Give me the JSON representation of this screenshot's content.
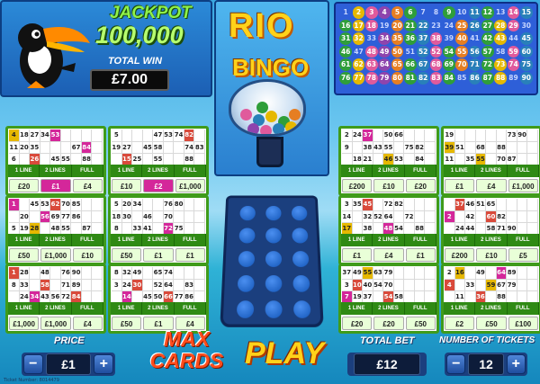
{
  "jackpot": {
    "label": "JACKPOT",
    "value": "100,000"
  },
  "total_win": {
    "label": "TOTAL WIN",
    "value": "£7.00"
  },
  "logo": {
    "line1": "RIO",
    "line2": "BINGO"
  },
  "balls": {
    "numbers": [
      1,
      2,
      3,
      4,
      5,
      6,
      7,
      8,
      9,
      10,
      11,
      12,
      13,
      14,
      15,
      16,
      17,
      18,
      19,
      20,
      21,
      22,
      23,
      24,
      25,
      26,
      27,
      28,
      29,
      30,
      31,
      32,
      33,
      34,
      35,
      36,
      37,
      38,
      39,
      40,
      41,
      42,
      43,
      44,
      45,
      46,
      47,
      48,
      49,
      50,
      51,
      52,
      52,
      54,
      55,
      56,
      57,
      58,
      59,
      60,
      61,
      62,
      63,
      64,
      65,
      66,
      67,
      68,
      69,
      70,
      71,
      72,
      73,
      74,
      75,
      76,
      77,
      78,
      79,
      80,
      81,
      82,
      83,
      84,
      85,
      86,
      87,
      88,
      89,
      90
    ],
    "colors": [
      "#2f9e3a",
      "#e6b800",
      "#e05a9c",
      "#8e44ad",
      "#e67e22",
      "#2f9e3a",
      "#2980b9",
      "#e05a9c",
      "#2f9e3a",
      "#e67e22",
      "#2980b9",
      "#2f9e3a",
      "#e6b800",
      "#e05a9c",
      "#2980b9"
    ],
    "called": [
      2,
      3,
      4,
      5,
      6,
      9,
      11,
      12,
      14,
      15,
      16,
      17,
      18,
      20,
      21,
      22,
      25,
      26,
      27,
      28,
      29,
      31,
      32,
      34,
      35,
      36,
      37,
      38,
      40,
      42,
      43,
      45,
      46,
      48,
      49,
      50,
      52,
      53,
      54,
      55,
      56,
      57,
      59,
      60,
      61,
      62,
      63,
      64,
      65,
      66,
      67,
      68,
      69,
      70,
      71,
      72,
      73,
      74,
      75,
      76,
      77,
      78,
      79,
      80,
      81,
      82,
      83,
      84,
      86,
      87,
      88,
      90
    ]
  },
  "card_labels": [
    "1 LINE",
    "2 LINES",
    "FULL HOUSE"
  ],
  "cards": [
    {
      "nums": [
        [
          4,
          18,
          27,
          34,
          53,
          "",
          "",
          "",
          ""
        ],
        [
          11,
          20,
          35,
          "",
          "",
          "",
          67,
          84,
          ""
        ],
        [
          6,
          "",
          26,
          "",
          45,
          55,
          "",
          88,
          ""
        ]
      ],
      "prizes": [
        "£20",
        "£1",
        "£4"
      ],
      "hl": [
        1
      ]
    },
    {
      "nums": [
        [
          5,
          "",
          "",
          "",
          47,
          53,
          74,
          82,
          ""
        ],
        [
          19,
          27,
          "",
          45,
          58,
          "",
          "",
          74,
          83
        ],
        [
          "",
          15,
          25,
          "",
          55,
          "",
          "",
          88,
          ""
        ]
      ],
      "prizes": [
        "£10",
        "£2",
        "£1,000"
      ],
      "hl": [
        1
      ]
    },
    {
      "nums": [
        [
          2,
          24,
          37,
          "",
          50,
          66,
          "",
          "",
          ""
        ],
        [
          9,
          "",
          38,
          43,
          55,
          "",
          75,
          82,
          ""
        ],
        [
          "",
          18,
          21,
          "",
          46,
          53,
          "",
          84,
          ""
        ]
      ],
      "prizes": [
        "£200",
        "£10",
        "£20"
      ],
      "hl": []
    },
    {
      "nums": [
        [
          19,
          "",
          "",
          "",
          "",
          "",
          73,
          90,
          ""
        ],
        [
          39,
          51,
          "",
          68,
          "",
          88,
          "",
          "",
          ""
        ],
        [
          11,
          "",
          35,
          55,
          "",
          70,
          87,
          "",
          ""
        ]
      ],
      "prizes": [
        "£1",
        "£4",
        "£1,000"
      ],
      "hl": []
    },
    {
      "nums": [
        [
          1,
          "",
          45,
          53,
          62,
          70,
          85,
          "",
          ""
        ],
        [
          "",
          20,
          "",
          56,
          69,
          77,
          86,
          "",
          ""
        ],
        [
          5,
          19,
          28,
          "",
          48,
          55,
          "",
          87,
          ""
        ]
      ],
      "prizes": [
        "£50",
        "£1,000",
        "£10"
      ],
      "hl": []
    },
    {
      "nums": [
        [
          5,
          20,
          34,
          "",
          "",
          76,
          80,
          "",
          ""
        ],
        [
          18,
          30,
          "",
          46,
          "",
          70,
          "",
          "",
          ""
        ],
        [
          8,
          "",
          33,
          41,
          "",
          72,
          75,
          "",
          ""
        ]
      ],
      "prizes": [
        "£50",
        "£1",
        "£1"
      ],
      "hl": []
    },
    {
      "nums": [
        [
          3,
          35,
          45,
          "",
          72,
          82,
          "",
          "",
          ""
        ],
        [
          14,
          "",
          32,
          52,
          64,
          "",
          72,
          "",
          ""
        ],
        [
          17,
          "",
          38,
          "",
          48,
          54,
          "",
          88,
          ""
        ]
      ],
      "prizes": [
        "£1",
        "£4",
        "£1"
      ],
      "hl": []
    },
    {
      "nums": [
        [
          "",
          37,
          46,
          51,
          65,
          "",
          "",
          "",
          ""
        ],
        [
          2,
          "",
          42,
          "",
          60,
          82,
          "",
          "",
          ""
        ],
        [
          "",
          24,
          44,
          "",
          58,
          71,
          90,
          "",
          ""
        ]
      ],
      "prizes": [
        "£200",
        "£10",
        "£5"
      ],
      "hl": []
    },
    {
      "nums": [
        [
          1,
          28,
          "",
          48,
          "",
          76,
          90,
          "",
          ""
        ],
        [
          8,
          33,
          "",
          58,
          "",
          71,
          89,
          "",
          ""
        ],
        [
          "",
          24,
          34,
          43,
          56,
          72,
          84,
          "",
          ""
        ]
      ],
      "prizes": [
        "£1,000",
        "£1,000",
        "£4"
      ],
      "hl": []
    },
    {
      "nums": [
        [
          8,
          32,
          49,
          "",
          65,
          74,
          "",
          "",
          ""
        ],
        [
          3,
          24,
          30,
          "",
          52,
          64,
          "",
          83,
          ""
        ],
        [
          "",
          14,
          "",
          45,
          50,
          66,
          77,
          86,
          ""
        ]
      ],
      "prizes": [
        "£50",
        "£1",
        "£4"
      ],
      "hl": []
    },
    {
      "nums": [
        [
          37,
          49,
          55,
          63,
          79,
          "",
          "",
          "",
          ""
        ],
        [
          3,
          10,
          40,
          54,
          70,
          "",
          "",
          "",
          ""
        ],
        [
          7,
          19,
          37,
          "",
          54,
          58,
          "",
          "",
          ""
        ]
      ],
      "prizes": [
        "£20",
        "£20",
        "£50"
      ],
      "hl": []
    },
    {
      "nums": [
        [
          2,
          16,
          "",
          49,
          "",
          64,
          89,
          "",
          ""
        ],
        [
          4,
          "",
          33,
          "",
          59,
          67,
          79,
          "",
          ""
        ],
        [
          "",
          11,
          "",
          36,
          "",
          88,
          "",
          "",
          ""
        ]
      ],
      "prizes": [
        "£2",
        "£50",
        "£100"
      ],
      "hl": []
    }
  ],
  "controls": {
    "price_label": "PRICE",
    "price_value": "£1",
    "max_cards": "MAX CARDS",
    "play": "PLAY",
    "total_bet_label": "TOTAL BET",
    "total_bet_value": "£12",
    "tickets_label": "NUMBER OF TICKETS",
    "tickets_value": "12",
    "minus": "−",
    "plus": "+"
  },
  "ticket_footer": "Ticket Number: 8014479"
}
